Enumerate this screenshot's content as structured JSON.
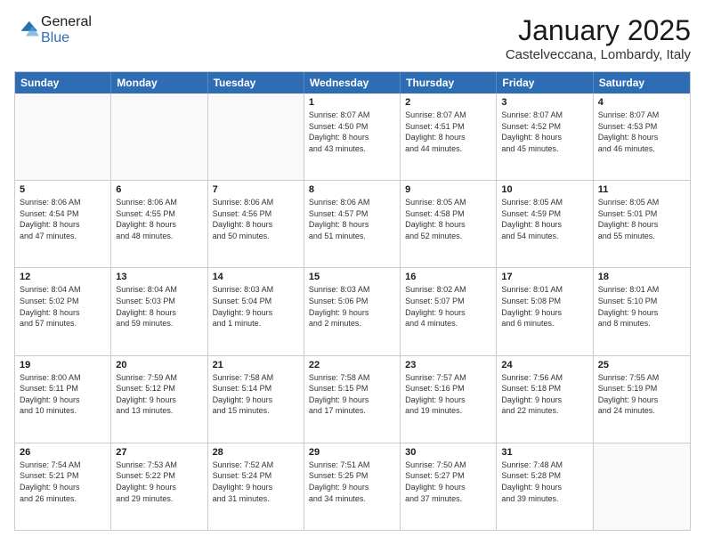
{
  "logo": {
    "line1": "General",
    "line2": "Blue"
  },
  "title": "January 2025",
  "subtitle": "Castelveccana, Lombardy, Italy",
  "days": [
    "Sunday",
    "Monday",
    "Tuesday",
    "Wednesday",
    "Thursday",
    "Friday",
    "Saturday"
  ],
  "weeks": [
    [
      {
        "day": "",
        "info": ""
      },
      {
        "day": "",
        "info": ""
      },
      {
        "day": "",
        "info": ""
      },
      {
        "day": "1",
        "info": "Sunrise: 8:07 AM\nSunset: 4:50 PM\nDaylight: 8 hours\nand 43 minutes."
      },
      {
        "day": "2",
        "info": "Sunrise: 8:07 AM\nSunset: 4:51 PM\nDaylight: 8 hours\nand 44 minutes."
      },
      {
        "day": "3",
        "info": "Sunrise: 8:07 AM\nSunset: 4:52 PM\nDaylight: 8 hours\nand 45 minutes."
      },
      {
        "day": "4",
        "info": "Sunrise: 8:07 AM\nSunset: 4:53 PM\nDaylight: 8 hours\nand 46 minutes."
      }
    ],
    [
      {
        "day": "5",
        "info": "Sunrise: 8:06 AM\nSunset: 4:54 PM\nDaylight: 8 hours\nand 47 minutes."
      },
      {
        "day": "6",
        "info": "Sunrise: 8:06 AM\nSunset: 4:55 PM\nDaylight: 8 hours\nand 48 minutes."
      },
      {
        "day": "7",
        "info": "Sunrise: 8:06 AM\nSunset: 4:56 PM\nDaylight: 8 hours\nand 50 minutes."
      },
      {
        "day": "8",
        "info": "Sunrise: 8:06 AM\nSunset: 4:57 PM\nDaylight: 8 hours\nand 51 minutes."
      },
      {
        "day": "9",
        "info": "Sunrise: 8:05 AM\nSunset: 4:58 PM\nDaylight: 8 hours\nand 52 minutes."
      },
      {
        "day": "10",
        "info": "Sunrise: 8:05 AM\nSunset: 4:59 PM\nDaylight: 8 hours\nand 54 minutes."
      },
      {
        "day": "11",
        "info": "Sunrise: 8:05 AM\nSunset: 5:01 PM\nDaylight: 8 hours\nand 55 minutes."
      }
    ],
    [
      {
        "day": "12",
        "info": "Sunrise: 8:04 AM\nSunset: 5:02 PM\nDaylight: 8 hours\nand 57 minutes."
      },
      {
        "day": "13",
        "info": "Sunrise: 8:04 AM\nSunset: 5:03 PM\nDaylight: 8 hours\nand 59 minutes."
      },
      {
        "day": "14",
        "info": "Sunrise: 8:03 AM\nSunset: 5:04 PM\nDaylight: 9 hours\nand 1 minute."
      },
      {
        "day": "15",
        "info": "Sunrise: 8:03 AM\nSunset: 5:06 PM\nDaylight: 9 hours\nand 2 minutes."
      },
      {
        "day": "16",
        "info": "Sunrise: 8:02 AM\nSunset: 5:07 PM\nDaylight: 9 hours\nand 4 minutes."
      },
      {
        "day": "17",
        "info": "Sunrise: 8:01 AM\nSunset: 5:08 PM\nDaylight: 9 hours\nand 6 minutes."
      },
      {
        "day": "18",
        "info": "Sunrise: 8:01 AM\nSunset: 5:10 PM\nDaylight: 9 hours\nand 8 minutes."
      }
    ],
    [
      {
        "day": "19",
        "info": "Sunrise: 8:00 AM\nSunset: 5:11 PM\nDaylight: 9 hours\nand 10 minutes."
      },
      {
        "day": "20",
        "info": "Sunrise: 7:59 AM\nSunset: 5:12 PM\nDaylight: 9 hours\nand 13 minutes."
      },
      {
        "day": "21",
        "info": "Sunrise: 7:58 AM\nSunset: 5:14 PM\nDaylight: 9 hours\nand 15 minutes."
      },
      {
        "day": "22",
        "info": "Sunrise: 7:58 AM\nSunset: 5:15 PM\nDaylight: 9 hours\nand 17 minutes."
      },
      {
        "day": "23",
        "info": "Sunrise: 7:57 AM\nSunset: 5:16 PM\nDaylight: 9 hours\nand 19 minutes."
      },
      {
        "day": "24",
        "info": "Sunrise: 7:56 AM\nSunset: 5:18 PM\nDaylight: 9 hours\nand 22 minutes."
      },
      {
        "day": "25",
        "info": "Sunrise: 7:55 AM\nSunset: 5:19 PM\nDaylight: 9 hours\nand 24 minutes."
      }
    ],
    [
      {
        "day": "26",
        "info": "Sunrise: 7:54 AM\nSunset: 5:21 PM\nDaylight: 9 hours\nand 26 minutes."
      },
      {
        "day": "27",
        "info": "Sunrise: 7:53 AM\nSunset: 5:22 PM\nDaylight: 9 hours\nand 29 minutes."
      },
      {
        "day": "28",
        "info": "Sunrise: 7:52 AM\nSunset: 5:24 PM\nDaylight: 9 hours\nand 31 minutes."
      },
      {
        "day": "29",
        "info": "Sunrise: 7:51 AM\nSunset: 5:25 PM\nDaylight: 9 hours\nand 34 minutes."
      },
      {
        "day": "30",
        "info": "Sunrise: 7:50 AM\nSunset: 5:27 PM\nDaylight: 9 hours\nand 37 minutes."
      },
      {
        "day": "31",
        "info": "Sunrise: 7:48 AM\nSunset: 5:28 PM\nDaylight: 9 hours\nand 39 minutes."
      },
      {
        "day": "",
        "info": ""
      }
    ]
  ]
}
